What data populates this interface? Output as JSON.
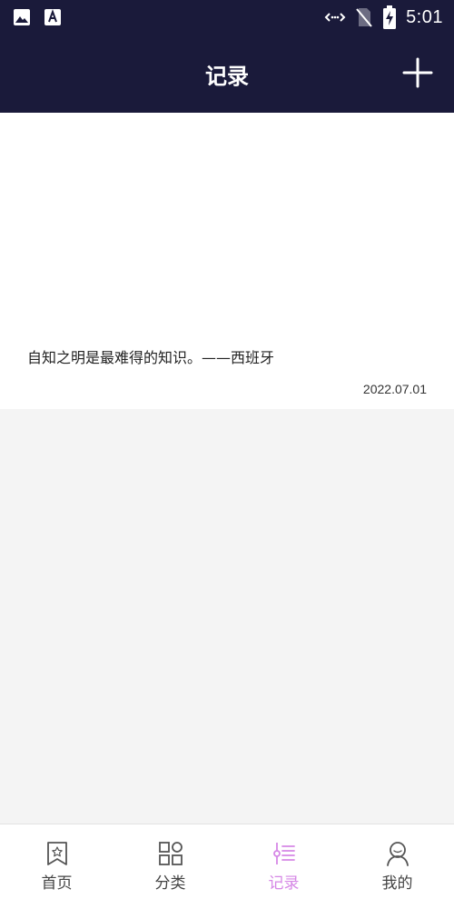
{
  "status_bar": {
    "time": "5:01",
    "left_icons": [
      "image-icon",
      "text-a-icon"
    ],
    "right_icons": [
      "wifi-icon",
      "no-sim-icon",
      "battery-charging-icon"
    ]
  },
  "header": {
    "title": "记录",
    "add_icon": "plus-icon"
  },
  "record": {
    "quote": "自知之明是最难得的知识。——西班牙",
    "date": "2022.07.01"
  },
  "bottom_nav": {
    "items": [
      {
        "label": "首页",
        "icon": "home-bookmark-icon"
      },
      {
        "label": "分类",
        "icon": "category-grid-icon"
      },
      {
        "label": "记录",
        "icon": "record-list-icon",
        "active": true
      },
      {
        "label": "我的",
        "icon": "profile-icon"
      }
    ]
  },
  "colors": {
    "header_bg": "#1a1a3a",
    "active_tab": "#d687e6",
    "page_bg": "#f4f4f4"
  }
}
